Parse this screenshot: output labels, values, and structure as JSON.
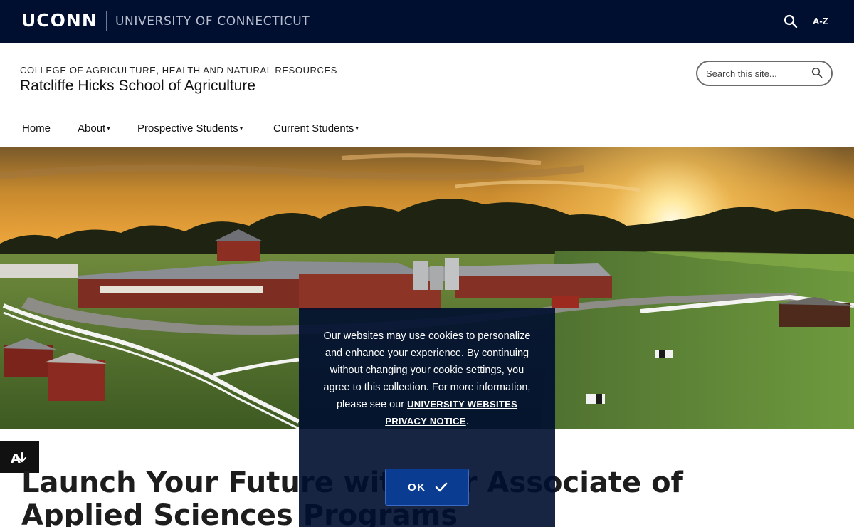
{
  "topbar": {
    "wordmark": "UCONN",
    "university_name": "UNIVERSITY OF CONNECTICUT",
    "search_icon": "search-icon",
    "az_label": "A-Z"
  },
  "site": {
    "college": "COLLEGE OF AGRICULTURE, HEALTH AND NATURAL RESOURCES",
    "title": "Ratcliffe Hicks School of Agriculture"
  },
  "search": {
    "placeholder": "Search this site...",
    "icon": "search-icon"
  },
  "nav": {
    "items": [
      {
        "label": "Home",
        "dropdown": false
      },
      {
        "label": "About",
        "dropdown": true
      },
      {
        "label": "Prospective Students",
        "dropdown": true
      },
      {
        "label": "Current Students",
        "dropdown": true
      }
    ],
    "caret": "▾"
  },
  "hero": {
    "icon": "farm-sunset-photo"
  },
  "accessibility": {
    "icon": "accessibility-icon"
  },
  "main": {
    "headline": "Launch Your Future with our Associate of Applied Sciences Programs"
  },
  "cookie": {
    "text_before": "Our websites may use cookies to personalize and enhance your experience. By continuing without changing your cookie settings, you agree to this collection. For more information, please see our ",
    "link_text": "UNIVERSITY WEBSITES PRIVACY NOTICE",
    "text_after": ".",
    "ok_label": "OK",
    "ok_icon": "checkmark-icon"
  },
  "colors": {
    "uconn_navy": "#000e2f",
    "button_blue": "#0a3d91"
  }
}
